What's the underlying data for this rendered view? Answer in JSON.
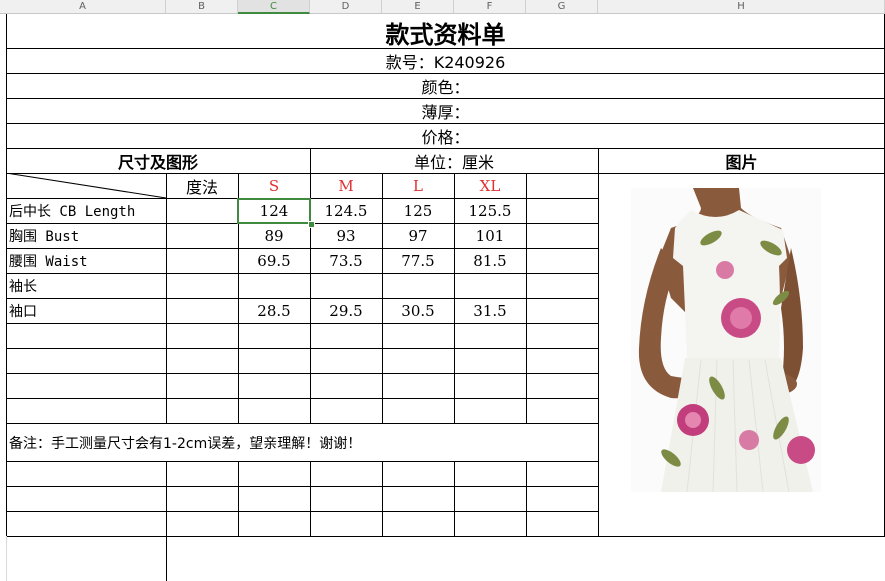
{
  "column_headers": [
    "A",
    "B",
    "C",
    "D",
    "E",
    "F",
    "G",
    "H"
  ],
  "title": "款式资料单",
  "style_no": "款号：K240926",
  "color_label": "颜色：",
  "thickness_label": "薄厚：",
  "price_label": "价格：",
  "size_section": "尺寸及图形",
  "unit": "单位：厘米",
  "picture_label": "图片",
  "method_label": "度法",
  "sizes": [
    "S",
    "M",
    "L",
    "XL"
  ],
  "measurements": [
    {
      "name": "后中长 CB Length",
      "values": [
        "124",
        "124.5",
        "125",
        "125.5"
      ]
    },
    {
      "name": "胸围 Bust",
      "values": [
        "89",
        "93",
        "97",
        "101"
      ]
    },
    {
      "name": "腰围 Waist",
      "values": [
        "69.5",
        "73.5",
        "77.5",
        "81.5"
      ]
    },
    {
      "name": "袖长",
      "values": [
        "",
        "",
        "",
        ""
      ]
    },
    {
      "name": "袖口",
      "values": [
        "28.5",
        "29.5",
        "30.5",
        "31.5"
      ]
    }
  ],
  "note": "备注：手工测量尺寸会有1-2cm误差，望亲理解！谢谢！",
  "colors": {
    "size_header": "#e03030",
    "selection": "#3f8a3f",
    "grid": "#000000"
  }
}
